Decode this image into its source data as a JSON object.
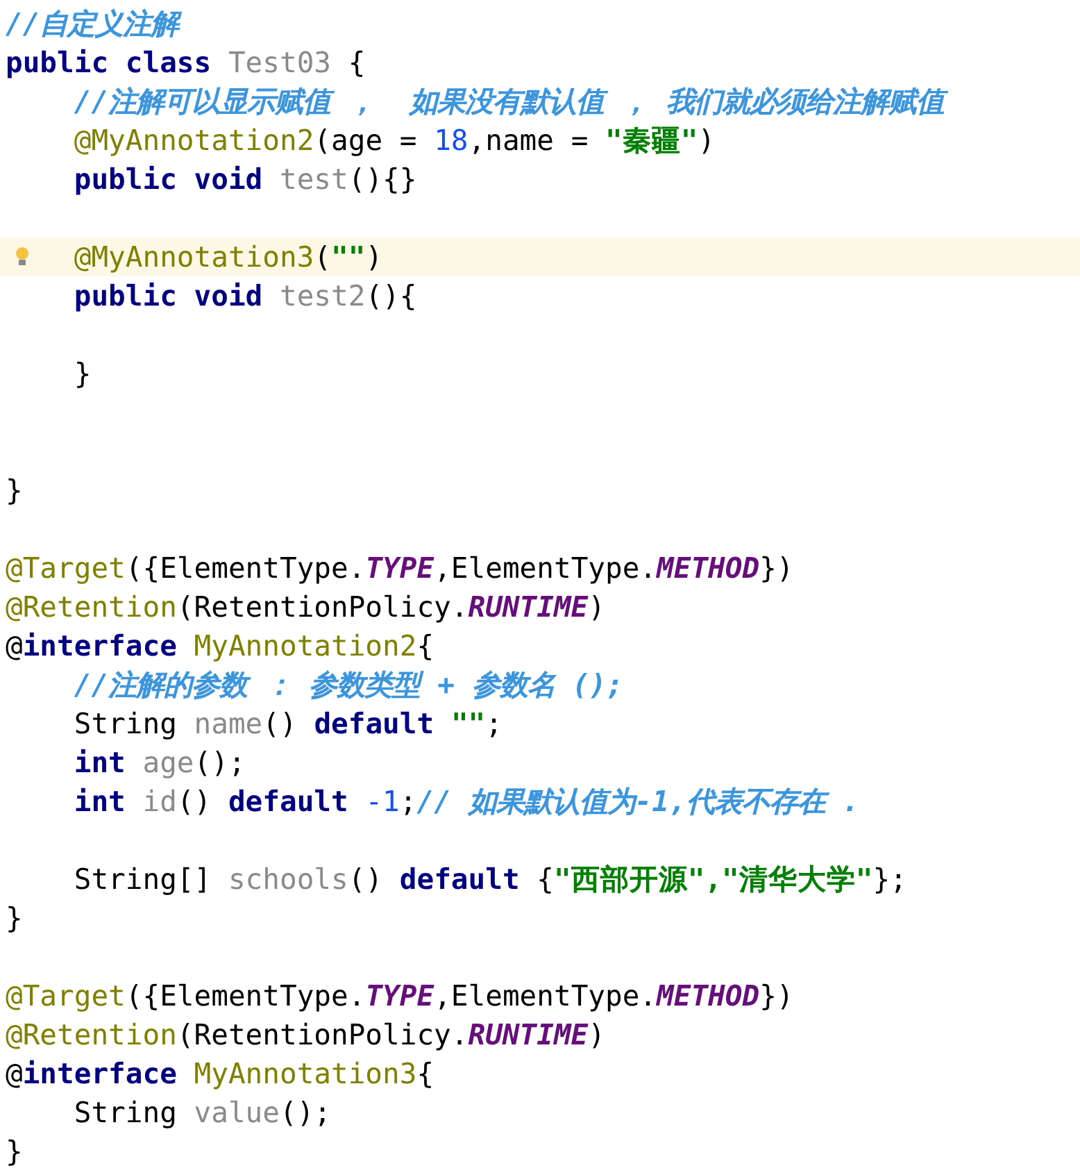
{
  "editor": {
    "lines": [
      {
        "kind": "code",
        "current": false,
        "tokens": [
          {
            "text": "//自定义注解",
            "kind": "comment"
          }
        ]
      },
      {
        "kind": "code",
        "current": false,
        "tokens": [
          {
            "text": "public class ",
            "kind": "keyword"
          },
          {
            "text": "Test03",
            "kind": "identifier"
          },
          {
            "text": " {",
            "kind": "plain"
          }
        ]
      },
      {
        "kind": "code",
        "current": false,
        "tokens": [
          {
            "text": "    //注解可以显示赋值 ，  如果没有默认值 ， 我们就必须给注解赋值",
            "kind": "comment"
          }
        ]
      },
      {
        "kind": "code",
        "current": false,
        "tokens": [
          {
            "text": "    @MyAnnotation2",
            "kind": "annotation"
          },
          {
            "text": "(age = ",
            "kind": "plain"
          },
          {
            "text": "18",
            "kind": "number"
          },
          {
            "text": ",name = ",
            "kind": "plain"
          },
          {
            "text": "\"秦疆\"",
            "kind": "string"
          },
          {
            "text": ")",
            "kind": "plain"
          }
        ]
      },
      {
        "kind": "code",
        "current": false,
        "tokens": [
          {
            "text": "    public void ",
            "kind": "keyword"
          },
          {
            "text": "test",
            "kind": "identifier"
          },
          {
            "text": "(){}",
            "kind": "plain"
          }
        ]
      },
      {
        "kind": "blank"
      },
      {
        "kind": "code",
        "current": true,
        "tokens": [
          {
            "text": "    @MyAnnotation3",
            "kind": "annotation"
          },
          {
            "text": "(",
            "kind": "plain"
          },
          {
            "text": "\"\"",
            "kind": "string"
          },
          {
            "text": ")",
            "kind": "plain"
          }
        ]
      },
      {
        "kind": "code",
        "current": false,
        "tokens": [
          {
            "text": "    public void ",
            "kind": "keyword"
          },
          {
            "text": "test2",
            "kind": "identifier"
          },
          {
            "text": "(){",
            "kind": "plain"
          }
        ]
      },
      {
        "kind": "blank"
      },
      {
        "kind": "code",
        "current": false,
        "tokens": [
          {
            "text": "    }",
            "kind": "plain"
          }
        ]
      },
      {
        "kind": "blank"
      },
      {
        "kind": "blank"
      },
      {
        "kind": "code",
        "current": false,
        "tokens": [
          {
            "text": "}",
            "kind": "plain"
          }
        ]
      },
      {
        "kind": "blank"
      },
      {
        "kind": "code",
        "current": false,
        "tokens": [
          {
            "text": "@Target",
            "kind": "annotation"
          },
          {
            "text": "({ElementType.",
            "kind": "plain"
          },
          {
            "text": "TYPE",
            "kind": "constant"
          },
          {
            "text": ",ElementType.",
            "kind": "plain"
          },
          {
            "text": "METHOD",
            "kind": "constant"
          },
          {
            "text": "})",
            "kind": "plain"
          }
        ]
      },
      {
        "kind": "code",
        "current": false,
        "tokens": [
          {
            "text": "@Retention",
            "kind": "annotation"
          },
          {
            "text": "(RetentionPolicy.",
            "kind": "plain"
          },
          {
            "text": "RUNTIME",
            "kind": "constant"
          },
          {
            "text": ")",
            "kind": "plain"
          }
        ]
      },
      {
        "kind": "code",
        "current": false,
        "tokens": [
          {
            "text": "@",
            "kind": "plain"
          },
          {
            "text": "interface ",
            "kind": "keyword"
          },
          {
            "text": "MyAnnotation2",
            "kind": "annotation"
          },
          {
            "text": "{",
            "kind": "plain"
          }
        ]
      },
      {
        "kind": "code",
        "current": false,
        "tokens": [
          {
            "text": "    //注解的参数 ： 参数类型 + 参数名 ();",
            "kind": "comment"
          }
        ]
      },
      {
        "kind": "code",
        "current": false,
        "tokens": [
          {
            "text": "    String ",
            "kind": "plain"
          },
          {
            "text": "name",
            "kind": "identifier"
          },
          {
            "text": "() ",
            "kind": "plain"
          },
          {
            "text": "default ",
            "kind": "keyword"
          },
          {
            "text": "\"\"",
            "kind": "string"
          },
          {
            "text": ";",
            "kind": "plain"
          }
        ]
      },
      {
        "kind": "code",
        "current": false,
        "tokens": [
          {
            "text": "    int ",
            "kind": "keyword"
          },
          {
            "text": "age",
            "kind": "identifier"
          },
          {
            "text": "();",
            "kind": "plain"
          }
        ]
      },
      {
        "kind": "code",
        "current": false,
        "tokens": [
          {
            "text": "    int ",
            "kind": "keyword"
          },
          {
            "text": "id",
            "kind": "identifier"
          },
          {
            "text": "() ",
            "kind": "plain"
          },
          {
            "text": "default ",
            "kind": "keyword"
          },
          {
            "text": "-1",
            "kind": "number"
          },
          {
            "text": ";",
            "kind": "plain"
          },
          {
            "text": "// 如果默认值为-1,代表不存在 .",
            "kind": "comment"
          }
        ]
      },
      {
        "kind": "blank"
      },
      {
        "kind": "code",
        "current": false,
        "tokens": [
          {
            "text": "    String[] ",
            "kind": "plain"
          },
          {
            "text": "schools",
            "kind": "identifier"
          },
          {
            "text": "() ",
            "kind": "plain"
          },
          {
            "text": "default ",
            "kind": "keyword"
          },
          {
            "text": "{",
            "kind": "plain"
          },
          {
            "text": "\"西部开源\",\"清华大学\"",
            "kind": "string"
          },
          {
            "text": "};",
            "kind": "plain"
          }
        ]
      },
      {
        "kind": "code",
        "current": false,
        "tokens": [
          {
            "text": "}",
            "kind": "plain"
          }
        ]
      },
      {
        "kind": "blank"
      },
      {
        "kind": "code",
        "current": false,
        "tokens": [
          {
            "text": "@Target",
            "kind": "annotation"
          },
          {
            "text": "({ElementType.",
            "kind": "plain"
          },
          {
            "text": "TYPE",
            "kind": "constant"
          },
          {
            "text": ",ElementType.",
            "kind": "plain"
          },
          {
            "text": "METHOD",
            "kind": "constant"
          },
          {
            "text": "})",
            "kind": "plain"
          }
        ]
      },
      {
        "kind": "code",
        "current": false,
        "tokens": [
          {
            "text": "@Retention",
            "kind": "annotation"
          },
          {
            "text": "(RetentionPolicy.",
            "kind": "plain"
          },
          {
            "text": "RUNTIME",
            "kind": "constant"
          },
          {
            "text": ")",
            "kind": "plain"
          }
        ]
      },
      {
        "kind": "code",
        "current": false,
        "tokens": [
          {
            "text": "@",
            "kind": "plain"
          },
          {
            "text": "interface ",
            "kind": "keyword"
          },
          {
            "text": "MyAnnotation3",
            "kind": "annotation"
          },
          {
            "text": "{",
            "kind": "plain"
          }
        ]
      },
      {
        "kind": "code",
        "current": false,
        "tokens": [
          {
            "text": "    String ",
            "kind": "plain"
          },
          {
            "text": "value",
            "kind": "identifier"
          },
          {
            "text": "();",
            "kind": "plain"
          }
        ]
      },
      {
        "kind": "code",
        "current": false,
        "tokens": [
          {
            "text": "}",
            "kind": "plain"
          }
        ]
      }
    ]
  }
}
